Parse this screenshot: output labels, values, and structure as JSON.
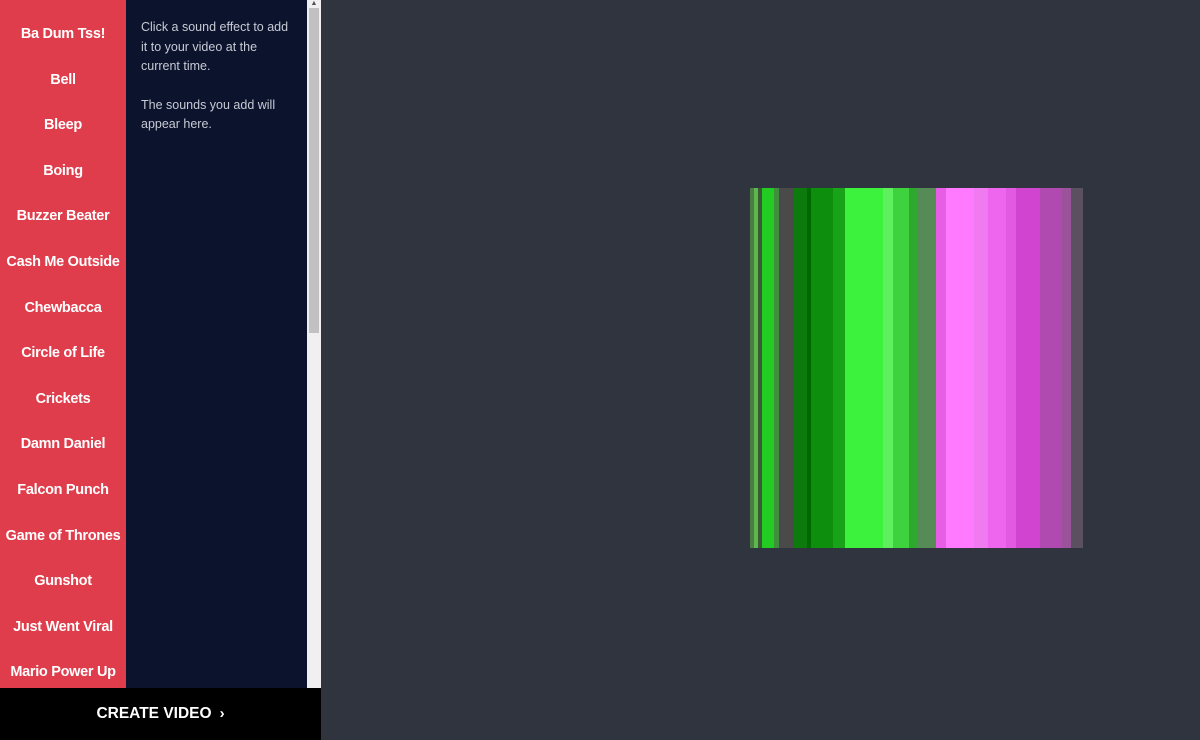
{
  "sidebar": {
    "sounds": [
      "Ba Dum Tss!",
      "Bell",
      "Bleep",
      "Boing",
      "Buzzer Beater",
      "Cash Me Outside",
      "Chewbacca",
      "Circle of Life",
      "Crickets",
      "Damn Daniel",
      "Falcon Punch",
      "Game of Thrones",
      "Gunshot",
      "Just Went Viral",
      "Mario Power Up"
    ]
  },
  "added_panel": {
    "instruction": "Click a sound effect to add it to your video at the current time.",
    "empty_hint": "The sounds you add will appear here."
  },
  "footer": {
    "create_label": "CREATE VIDEO",
    "create_icon": "chevron-right-icon"
  },
  "preview": {
    "stripes": [
      {
        "w": 4,
        "color": "#4a7d44"
      },
      {
        "w": 4,
        "color": "#5cb84c"
      },
      {
        "w": 4,
        "color": "#3a5a36"
      },
      {
        "w": 12,
        "color": "#22cc22"
      },
      {
        "w": 5,
        "color": "#3f8f3c"
      },
      {
        "w": 15,
        "color": "#4a4a4a"
      },
      {
        "w": 13,
        "color": "#0c7a0c"
      },
      {
        "w": 4,
        "color": "#006a00"
      },
      {
        "w": 22,
        "color": "#0d8f0d"
      },
      {
        "w": 12,
        "color": "#19a319"
      },
      {
        "w": 38,
        "color": "#3cf23c"
      },
      {
        "w": 10,
        "color": "#5ef05e"
      },
      {
        "w": 16,
        "color": "#3ed23e"
      },
      {
        "w": 9,
        "color": "#2ea82e"
      },
      {
        "w": 18,
        "color": "#568a56"
      },
      {
        "w": 10,
        "color": "#e65ee6"
      },
      {
        "w": 28,
        "color": "#ff7aff"
      },
      {
        "w": 14,
        "color": "#f07af0"
      },
      {
        "w": 18,
        "color": "#ee66ee"
      },
      {
        "w": 10,
        "color": "#e25ae2"
      },
      {
        "w": 24,
        "color": "#d044d0"
      },
      {
        "w": 22,
        "color": "#b04ab0"
      },
      {
        "w": 9,
        "color": "#9a529a"
      },
      {
        "w": 12,
        "color": "#5a5060"
      }
    ]
  }
}
